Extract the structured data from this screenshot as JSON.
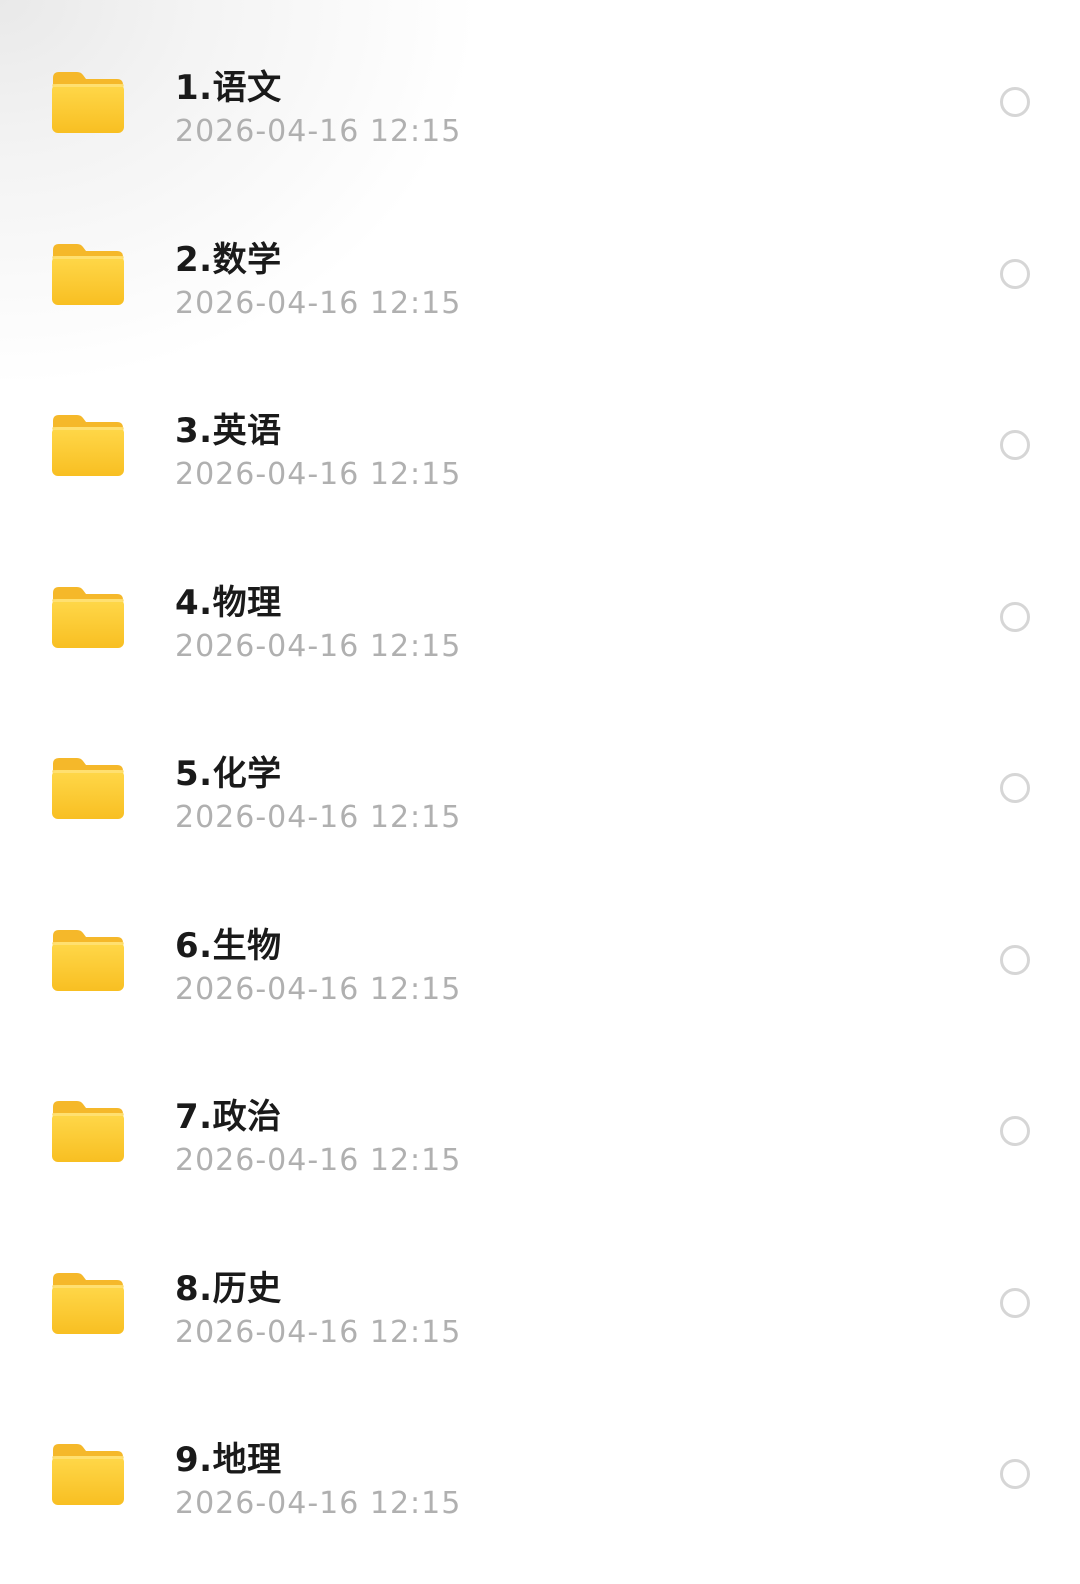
{
  "colors": {
    "folder": "#FBC531",
    "title": "#1a1a1a",
    "meta": "#b0b0b0",
    "radio_border": "#d6d6d6"
  },
  "files": [
    {
      "name": "1.语文",
      "modified": "2026-04-16 12:15",
      "icon": "folder-icon"
    },
    {
      "name": "2.数学",
      "modified": "2026-04-16 12:15",
      "icon": "folder-icon"
    },
    {
      "name": "3.英语",
      "modified": "2026-04-16 12:15",
      "icon": "folder-icon"
    },
    {
      "name": "4.物理",
      "modified": "2026-04-16 12:15",
      "icon": "folder-icon"
    },
    {
      "name": "5.化学",
      "modified": "2026-04-16 12:15",
      "icon": "folder-icon"
    },
    {
      "name": "6.生物",
      "modified": "2026-04-16 12:15",
      "icon": "folder-icon"
    },
    {
      "name": "7.政治",
      "modified": "2026-04-16 12:15",
      "icon": "folder-icon"
    },
    {
      "name": "8.历史",
      "modified": "2026-04-16 12:15",
      "icon": "folder-icon"
    },
    {
      "name": "9.地理",
      "modified": "2026-04-16 12:15",
      "icon": "folder-icon"
    }
  ]
}
